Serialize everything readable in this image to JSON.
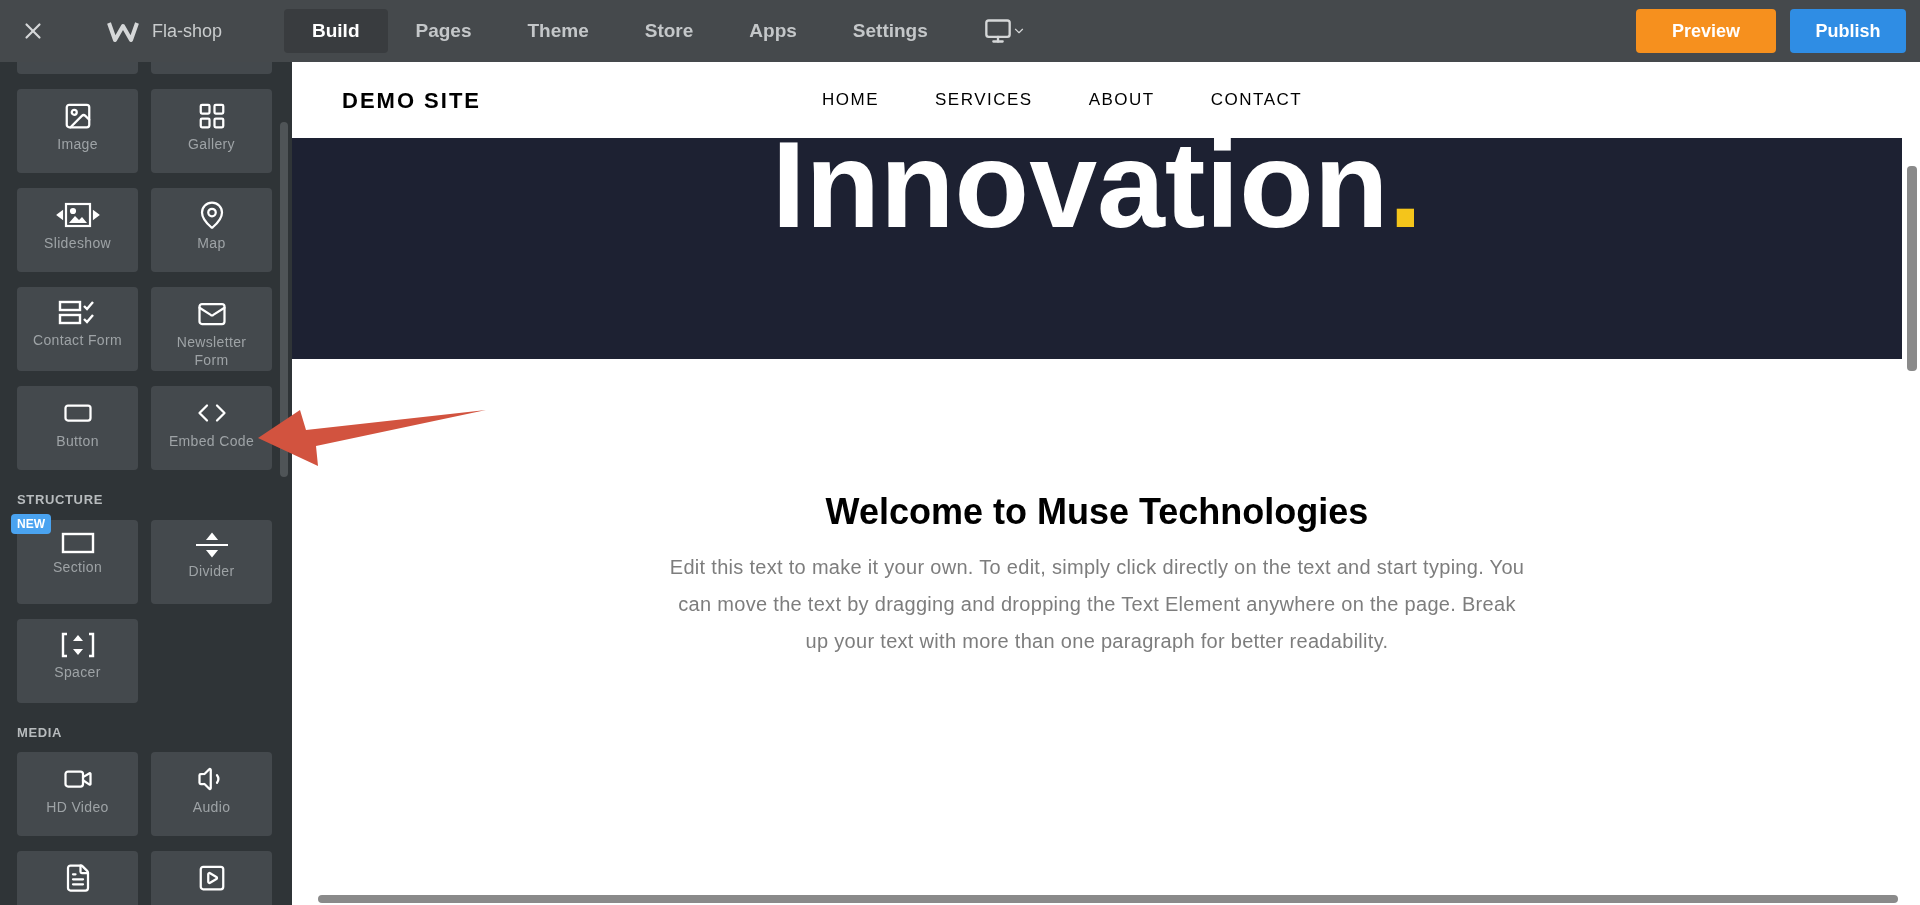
{
  "topbar": {
    "site_name": "Fla-shop",
    "tabs": [
      {
        "label": "Build",
        "selected": true
      },
      {
        "label": "Pages",
        "selected": false
      },
      {
        "label": "Theme",
        "selected": false
      },
      {
        "label": "Store",
        "selected": false
      },
      {
        "label": "Apps",
        "selected": false
      },
      {
        "label": "Settings",
        "selected": false
      }
    ],
    "buttons": [
      {
        "label": "Preview",
        "kind": "preview"
      },
      {
        "label": "Publish",
        "kind": "publish"
      }
    ]
  },
  "sidebar": {
    "sections": [
      {
        "elements": [
          {
            "kind": "blank"
          },
          {
            "kind": "blank"
          },
          {
            "label": "Image",
            "kind": "image"
          },
          {
            "label": "Gallery",
            "kind": "gallery"
          },
          {
            "label": "Slideshow",
            "kind": "slideshow"
          },
          {
            "label": "Map",
            "kind": "map"
          },
          {
            "label": "Contact Form",
            "kind": "form"
          },
          {
            "label": "Newsletter Form",
            "kind": "mail"
          },
          {
            "label": "Button",
            "kind": "button"
          },
          {
            "label": "Embed Code",
            "kind": "code"
          }
        ]
      },
      {
        "title": "STRUCTURE",
        "elements": [
          {
            "label": "Section",
            "kind": "section",
            "badge": "NEW"
          },
          {
            "label": "Divider",
            "kind": "divider"
          },
          {
            "label": "Spacer",
            "kind": "spacer"
          }
        ]
      },
      {
        "title": "MEDIA",
        "elements": [
          {
            "label": "HD Video",
            "kind": "video"
          },
          {
            "label": "Audio",
            "kind": "audio"
          },
          {
            "kind": "document"
          },
          {
            "kind": "play"
          }
        ]
      }
    ]
  },
  "site": {
    "logo": "DEMO SITE",
    "nav": [
      "HOME",
      "SERVICES",
      "ABOUT",
      "CONTACT"
    ],
    "hero_title": "Innovation",
    "hero_dot": ".",
    "heading": "Welcome to Muse Technologies",
    "paragraph": "Edit this text to make it your own. To edit, simply click directly on the text and start typing. You can move the text by dragging and dropping the Text Element anywhere on the page. Break up your text with more than one paragraph for better readability."
  }
}
